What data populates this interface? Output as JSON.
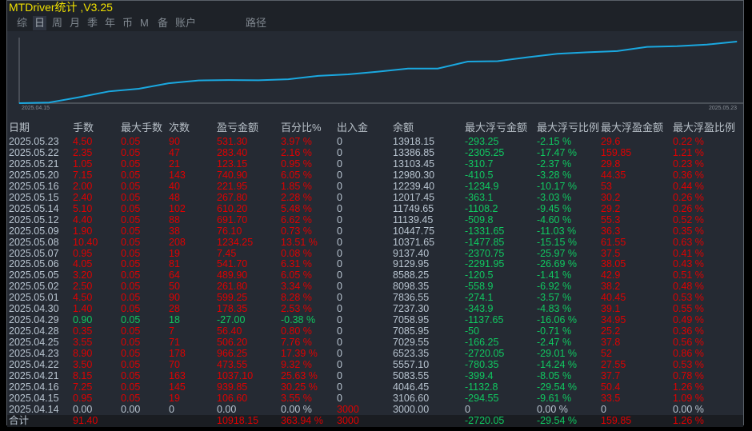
{
  "window": {
    "title": "MTDriver统计 ,V3.25"
  },
  "tabs": [
    {
      "label": "综",
      "active": false
    },
    {
      "label": "日",
      "active": true
    },
    {
      "label": "周",
      "active": false
    },
    {
      "label": "月",
      "active": false
    },
    {
      "label": "季",
      "active": false
    },
    {
      "label": "年",
      "active": false
    },
    {
      "label": "币",
      "active": false
    },
    {
      "label": "M",
      "active": false
    },
    {
      "label": "备",
      "active": false
    },
    {
      "label": "账户",
      "active": false
    },
    {
      "label": "路径",
      "active": false
    }
  ],
  "chart_data": {
    "type": "line",
    "x_start_label": "2025.04.15",
    "x_end_label": "2025.05.23",
    "line_color": "#1aa8e0",
    "x": [
      "2025.04.14",
      "2025.04.15",
      "2025.04.16",
      "2025.04.21",
      "2025.04.22",
      "2025.04.23",
      "2025.04.25",
      "2025.04.28",
      "2025.04.29",
      "2025.04.30",
      "2025.05.01",
      "2025.05.02",
      "2025.05.05",
      "2025.05.06",
      "2025.05.07",
      "2025.05.08",
      "2025.05.09",
      "2025.05.12",
      "2025.05.14",
      "2025.05.15",
      "2025.05.16",
      "2025.05.20",
      "2025.05.21",
      "2025.05.22",
      "2025.05.23"
    ],
    "values": [
      3000.0,
      3106.6,
      4046.45,
      5083.55,
      5557.1,
      6523.35,
      7029.55,
      7085.95,
      7058.95,
      7237.3,
      7836.55,
      8098.35,
      8588.25,
      9129.95,
      9137.4,
      10371.65,
      10447.75,
      11139.45,
      11749.65,
      12017.45,
      12239.4,
      12980.3,
      13103.45,
      13386.85,
      13918.15
    ]
  },
  "table": {
    "headers": [
      "日期",
      "手数",
      "最大手数",
      "次数",
      "盈亏金额",
      "百分比%",
      "出入金",
      "余额",
      "最大浮亏金额",
      "最大浮亏比例",
      "最大浮盈金额",
      "最大浮盈比例"
    ],
    "rows": [
      [
        "2025.05.23",
        "4.50",
        "0.05",
        "90",
        "531.30",
        "3.97 %",
        "0",
        "13918.15",
        "-293.25",
        "-2.15 %",
        "29.6",
        "0.22 %"
      ],
      [
        "2025.05.22",
        "2.35",
        "0.05",
        "47",
        "283.40",
        "2.16 %",
        "0",
        "13386.85",
        "-2305.25",
        "-17.47 %",
        "159.85",
        "1.21 %"
      ],
      [
        "2025.05.21",
        "1.05",
        "0.05",
        "21",
        "123.15",
        "0.95 %",
        "0",
        "13103.45",
        "-310.7",
        "-2.37 %",
        "29.8",
        "0.23 %"
      ],
      [
        "2025.05.20",
        "7.15",
        "0.05",
        "143",
        "740.90",
        "6.05 %",
        "0",
        "12980.30",
        "-410.5",
        "-3.28 %",
        "44.35",
        "0.36 %"
      ],
      [
        "2025.05.16",
        "2.00",
        "0.05",
        "40",
        "221.95",
        "1.85 %",
        "0",
        "12239.40",
        "-1234.9",
        "-10.17 %",
        "53",
        "0.44 %"
      ],
      [
        "2025.05.15",
        "2.40",
        "0.05",
        "48",
        "267.80",
        "2.28 %",
        "0",
        "12017.45",
        "-363.1",
        "-3.03 %",
        "30.2",
        "0.26 %"
      ],
      [
        "2025.05.14",
        "5.10",
        "0.05",
        "102",
        "610.20",
        "5.48 %",
        "0",
        "11749.65",
        "-1108.2",
        "-9.45 %",
        "29.2",
        "0.26 %"
      ],
      [
        "2025.05.12",
        "4.40",
        "0.05",
        "88",
        "691.70",
        "6.62 %",
        "0",
        "11139.45",
        "-509.8",
        "-4.60 %",
        "55.3",
        "0.52 %"
      ],
      [
        "2025.05.09",
        "1.90",
        "0.05",
        "38",
        "76.10",
        "0.73 %",
        "0",
        "10447.75",
        "-1331.65",
        "-11.03 %",
        "36.3",
        "0.35 %"
      ],
      [
        "2025.05.08",
        "10.40",
        "0.05",
        "208",
        "1234.25",
        "13.51 %",
        "0",
        "10371.65",
        "-1477.85",
        "-15.15 %",
        "61.55",
        "0.63 %"
      ],
      [
        "2025.05.07",
        "0.95",
        "0.05",
        "19",
        "7.45",
        "0.08 %",
        "0",
        "9137.40",
        "-2370.75",
        "-25.97 %",
        "37.5",
        "0.41 %"
      ],
      [
        "2025.05.06",
        "4.05",
        "0.05",
        "81",
        "541.70",
        "6.31 %",
        "0",
        "9129.95",
        "-2291.95",
        "-26.69 %",
        "38.05",
        "0.43 %"
      ],
      [
        "2025.05.05",
        "3.20",
        "0.05",
        "64",
        "489.90",
        "6.05 %",
        "0",
        "8588.25",
        "-120.5",
        "-1.41 %",
        "42.9",
        "0.51 %"
      ],
      [
        "2025.05.02",
        "2.50",
        "0.05",
        "50",
        "261.80",
        "3.34 %",
        "0",
        "8098.35",
        "-558.9",
        "-6.92 %",
        "38.2",
        "0.48 %"
      ],
      [
        "2025.05.01",
        "4.50",
        "0.05",
        "90",
        "599.25",
        "8.28 %",
        "0",
        "7836.55",
        "-274.1",
        "-3.57 %",
        "40.45",
        "0.53 %"
      ],
      [
        "2025.04.30",
        "1.40",
        "0.05",
        "28",
        "178.35",
        "2.53 %",
        "0",
        "7237.30",
        "-343.9",
        "-4.83 %",
        "39.1",
        "0.55 %"
      ],
      [
        "2025.04.29",
        "0.90",
        "0.05",
        "18",
        "-27.00",
        "-0.38 %",
        "0",
        "7058.95",
        "-1137.65",
        "-16.06 %",
        "34.95",
        "0.49 %"
      ],
      [
        "2025.04.28",
        "0.35",
        "0.05",
        "7",
        "56.40",
        "0.80 %",
        "0",
        "7085.95",
        "-50",
        "-0.71 %",
        "25.2",
        "0.36 %"
      ],
      [
        "2025.04.25",
        "3.55",
        "0.05",
        "71",
        "506.20",
        "7.76 %",
        "0",
        "7029.55",
        "-166.25",
        "-2.47 %",
        "37.8",
        "0.56 %"
      ],
      [
        "2025.04.23",
        "8.90",
        "0.05",
        "178",
        "966.25",
        "17.39 %",
        "0",
        "6523.35",
        "-2720.05",
        "-29.01 %",
        "52",
        "0.86 %"
      ],
      [
        "2025.04.22",
        "3.50",
        "0.05",
        "70",
        "473.55",
        "9.32 %",
        "0",
        "5557.10",
        "-780.35",
        "-14.24 %",
        "27.55",
        "0.53 %"
      ],
      [
        "2025.04.21",
        "8.15",
        "0.05",
        "163",
        "1037.10",
        "25.63 %",
        "0",
        "5083.55",
        "-399.4",
        "-8.05 %",
        "37.7",
        "0.78 %"
      ],
      [
        "2025.04.16",
        "7.25",
        "0.05",
        "145",
        "939.85",
        "30.25 %",
        "0",
        "4046.45",
        "-1132.8",
        "-29.54 %",
        "50.4",
        "1.26 %"
      ],
      [
        "2025.04.15",
        "0.95",
        "0.05",
        "19",
        "106.60",
        "3.55 %",
        "0",
        "3106.60",
        "-294.55",
        "-9.61 %",
        "33.5",
        "1.09 %"
      ],
      [
        "2025.04.14",
        "0.00",
        "0.00",
        "0",
        "0.00",
        "0.00 %",
        "3000",
        "3000.00",
        "0",
        "0.00 %",
        "0",
        "0.00 %"
      ]
    ],
    "total": [
      "合计",
      "91.40",
      "",
      "",
      "10918.15",
      "363.94 %",
      "3000",
      "",
      "-2720.05",
      "-29.54 %",
      "159.85",
      "1.26 %"
    ]
  },
  "colors": {
    "positive": "#e00000",
    "negative": "#10c860",
    "neutral": "#b8c4d0",
    "title": "#f0e000",
    "background": "#252a33"
  }
}
